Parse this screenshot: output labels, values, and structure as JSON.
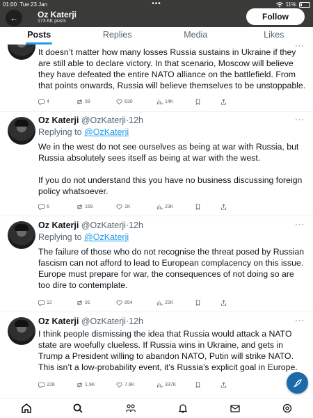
{
  "status_bar": {
    "time": "01:00",
    "date": "Tue 23 Jan",
    "battery": "11%"
  },
  "profile": {
    "name": "Oz Katerji",
    "posts_count": "173.6K posts",
    "follow_label": "Follow",
    "back_label": "←"
  },
  "tabs": [
    {
      "label": "Posts",
      "active": true
    },
    {
      "label": "Replies",
      "active": false
    },
    {
      "label": "Media",
      "active": false
    },
    {
      "label": "Likes",
      "active": false
    }
  ],
  "tweets": [
    {
      "body": [
        "It doesn’t matter how many losses Russia sustains in Ukraine if they are still able to declare victory. In that scenario, Moscow will believe they have defeated the entire NATO alliance on the battlefield. From that points onwards, Russia will believe themselves to be unstoppable."
      ],
      "replies": "4",
      "reposts": "59",
      "likes": "630",
      "views": "14K"
    },
    {
      "name": "Oz Katerji",
      "handle": "@OzKaterji",
      "time": "·12h",
      "replying_label": "Replying to",
      "replying_to": "@OzKaterji",
      "body": [
        "We in the west do not see ourselves as being at war with Russia, but Russia absolutely sees itself as being at war with the west.",
        "If you do not understand this you have no business discussing foreign policy whatsoever."
      ],
      "replies": "6",
      "reposts": "169",
      "likes": "1K",
      "views": "23K"
    },
    {
      "name": "Oz Katerji",
      "handle": "@OzKaterji",
      "time": "·12h",
      "replying_label": "Replying to",
      "replying_to": "@OzKaterji",
      "body": [
        "The failure of those who do not recognise the threat posed by Russian fascism can not afford to lead to European complacency on this issue. Europe must prepare for war, the consequences of not doing so are too dire to contemplate."
      ],
      "replies": "12",
      "reposts": "91",
      "likes": "854",
      "views": "22K"
    },
    {
      "name": "Oz Katerji",
      "handle": "@OzKaterji",
      "time": "·12h",
      "body": [
        "I think people dismissing the idea that Russia would attack a NATO state are woefully clueless. If Russia wins in Ukraine, and gets in Trump a President willing to abandon NATO, Putin will strike NATO. This isn’t a low-probability event, it’s Russia’s explicit goal in Europe."
      ],
      "replies": "228",
      "reposts": "1.9K",
      "likes": "7.8K",
      "views": "337K"
    }
  ],
  "more_label": "···",
  "colors": {
    "accent": "#1d9bf0",
    "compose": "#1d6aa8",
    "header": "#3a3a38"
  }
}
